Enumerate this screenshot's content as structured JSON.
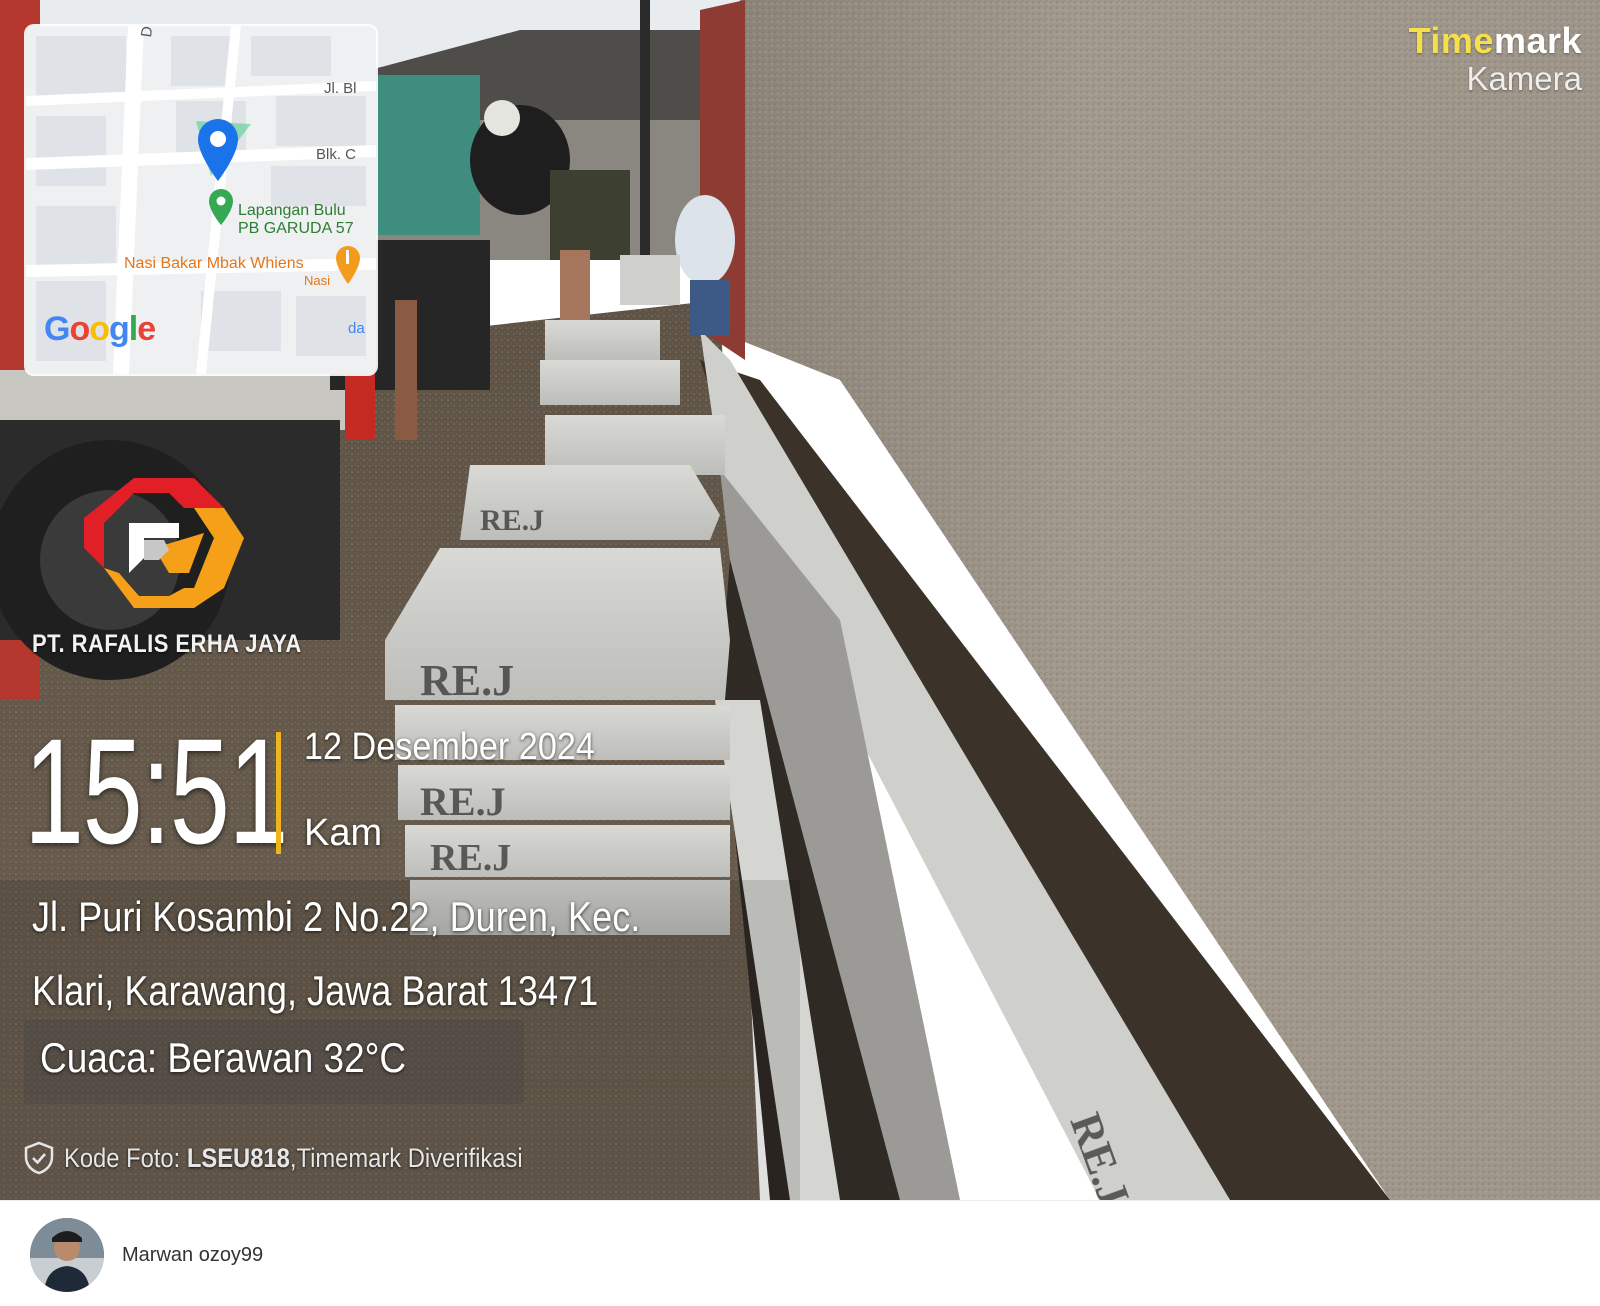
{
  "brand": {
    "name_highlight": "Time",
    "name_rest": "mark",
    "subtitle": "Kamera"
  },
  "map": {
    "streets": [
      "Dur",
      "Jl. Bl",
      "Blk. C"
    ],
    "place_green": "Lapangan Bulu PB GARUDA 57",
    "place_green_line1": "Lapangan Bulu",
    "place_green_line2": "PB GARUDA 57",
    "place_orange": "Nasi Bakar Mbak Whiens",
    "place_orange_sub": "Nasi",
    "edge_text": "da",
    "provider_letters": [
      "G",
      "o",
      "o",
      "g",
      "l",
      "e"
    ]
  },
  "company": {
    "name": "PT. RAFALIS ERHA JAYA"
  },
  "stamp": {
    "time": "15:51",
    "date": "12 Desember 2024",
    "day": "Kam",
    "address_line1": "Jl. Puri Kosambi 2 No.22, Duren, Kec.",
    "address_line2": "Klari, Karawang, Jawa Barat 13471",
    "weather": "Cuaca: Berawan 32°C",
    "verify_prefix": "Kode Foto: ",
    "verify_code": "LSEU818",
    "verify_suffix": ",Timemark Diverifikasi"
  },
  "footer": {
    "username": "Marwan ozoy99"
  },
  "colors": {
    "accent_yellow": "#f1b51c",
    "brand_yellow": "#f5e04b",
    "logo_red": "#e21f26",
    "logo_orange": "#f6a01a"
  },
  "icons": {
    "shield": "shield-check-icon",
    "pin": "location-pin-icon",
    "restaurant": "fork-knife-icon"
  }
}
